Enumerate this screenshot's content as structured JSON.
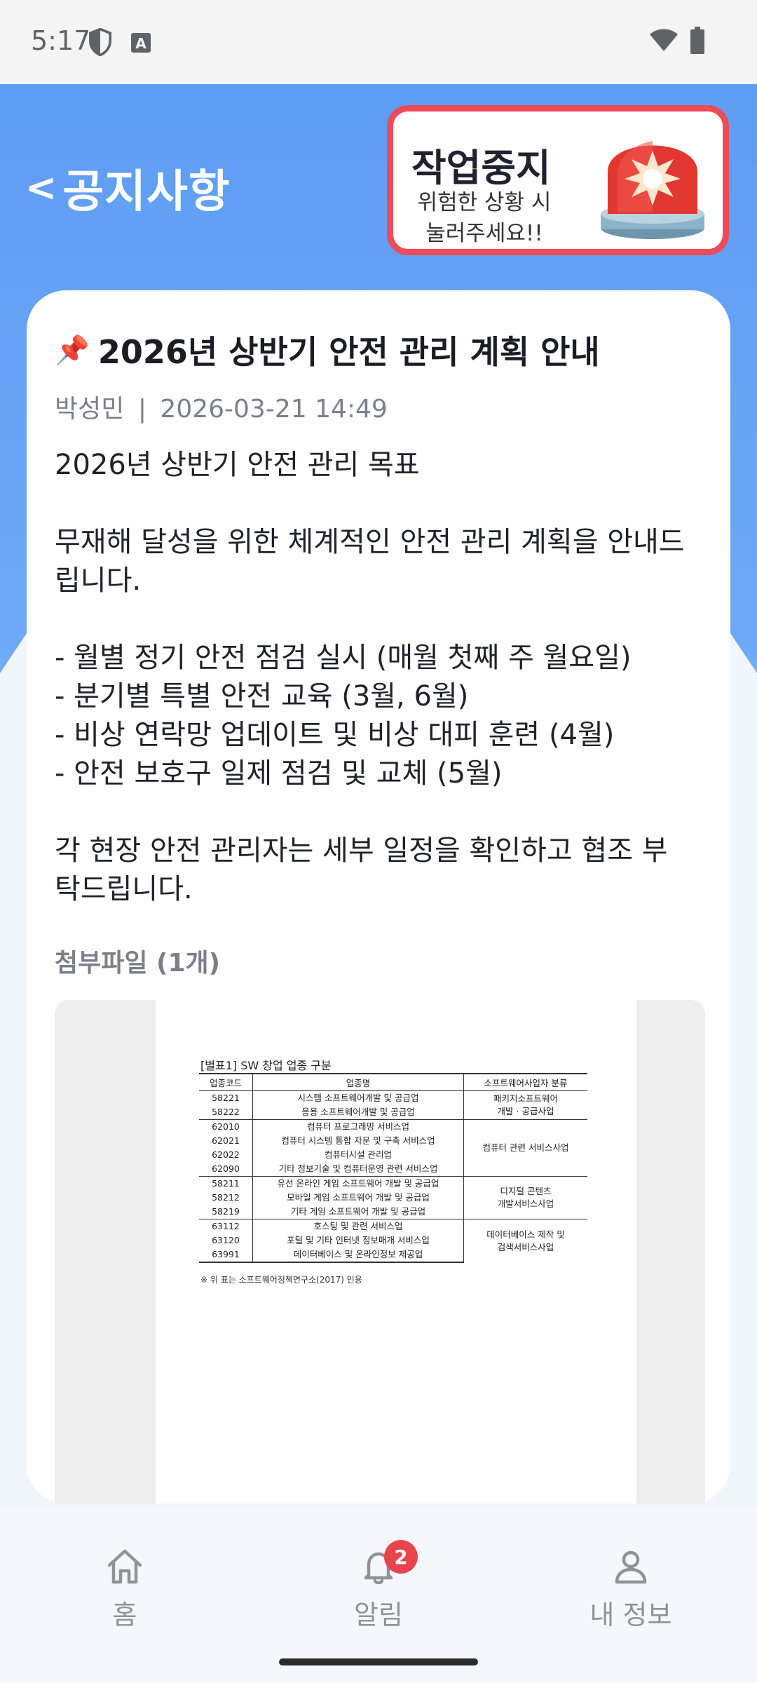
{
  "status_bar": {
    "time": "5:17",
    "icons": [
      "shield-icon",
      "font-a-icon",
      "wifi-icon",
      "battery-icon"
    ]
  },
  "header": {
    "back_symbol": "<",
    "title": "공지사항"
  },
  "emergency_stop": {
    "title": "작업중지",
    "subtitle_line1": "위험한 상황 시",
    "subtitle_line2": "눌러주세요!!",
    "accent": "#ec4b57"
  },
  "post": {
    "pin": "📌",
    "title": "2026년 상반기 안전 관리 계획 안내",
    "author": "박성민",
    "separator": "|",
    "datetime": "2026-03-21 14:49",
    "body": "2026년 상반기 안전 관리 목표\n\n무재해 달성을 위한 체계적인 안전 관리 계획을 안내드\n립니다.\n\n- 월별 정기 안전 점검 실시 (매월 첫째 주 월요일)\n- 분기별 특별 안전 교육 (3월, 6월)\n- 비상 연락망 업데이트 및 비상 대피 훈련 (4월)\n- 안전 보호구 일제 점검 및 교체 (5월)\n\n각 현장 안전 관리자는 세부 일정을 확인하고 협조 부\n탁드립니다.",
    "attachments_label": "첨부파일 (1개)"
  },
  "attachment_doc": {
    "caption": "[별표1] SW 창업 업종 구분",
    "headers": [
      "업종코드",
      "업종명",
      "소프트웨어사업자 분류"
    ],
    "rows": [
      [
        "58221",
        "시스템 소프트웨어개발 및 공급업"
      ],
      [
        "58222",
        "응용 소프트웨어개발 및 공급업"
      ],
      [
        "62010",
        "컴퓨터 프로그래밍 서비스업"
      ],
      [
        "62021",
        "컴퓨터 시스템 통합 자문 및 구축 서비스업"
      ],
      [
        "62022",
        "컴퓨터시설 관리업"
      ],
      [
        "62090",
        "기타 정보기술 및 컴퓨터운영 관련 서비스업"
      ],
      [
        "58211",
        "유선 온라인 게임 소프트웨어 개발 및 공급업"
      ],
      [
        "58212",
        "모바일 게임 소프트웨어 개발 및 공급업"
      ],
      [
        "58219",
        "기타 게임 소프트웨어 개발 및 공급업"
      ],
      [
        "63112",
        "호스팅 및 관련 서비스업"
      ],
      [
        "63120",
        "포털 및 기타 인터넷 정보매개 서비스업"
      ],
      [
        "63991",
        "데이터베이스 및 온라인정보 제공업"
      ]
    ],
    "categories": [
      [
        "패키지소프트웨어",
        "개발 · 공급사업"
      ],
      [
        "컴퓨터 관련 서비스사업"
      ],
      [
        "디지털 콘텐츠",
        "개발서비스사업"
      ],
      [
        "데이터베이스 제작 및",
        "검색서비스사업"
      ]
    ],
    "note": "※ 위 표는 소프트웨어정책연구소(2017) 인용"
  },
  "bottom_nav": {
    "items": [
      {
        "label": "홈",
        "icon": "home-icon"
      },
      {
        "label": "알림",
        "icon": "bell-icon",
        "badge": "2"
      },
      {
        "label": "내 정보",
        "icon": "person-icon"
      }
    ]
  }
}
